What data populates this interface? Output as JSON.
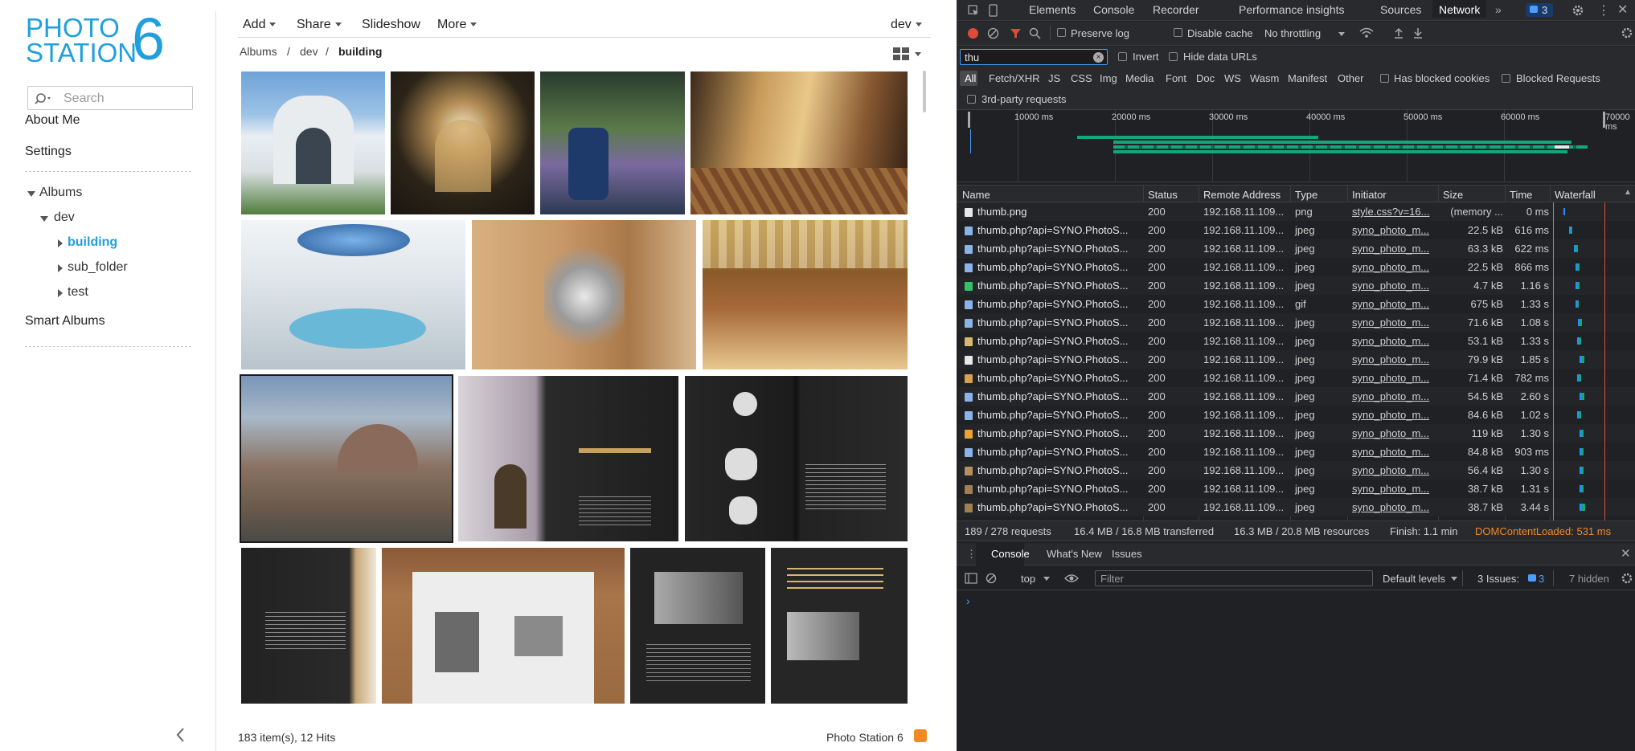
{
  "photo_station": {
    "logo": {
      "line1": "PHOTO",
      "line2": "STATION",
      "number": "6"
    },
    "search_placeholder": "Search",
    "sidebar": {
      "about_me": "About Me",
      "settings": "Settings",
      "albums": "Albums",
      "dev": "dev",
      "building": "building",
      "sub_folder": "sub_folder",
      "test": "test",
      "smart_albums": "Smart Albums"
    },
    "toolbar": {
      "add": "Add",
      "share": "Share",
      "slideshow": "Slideshow",
      "more": "More",
      "user": "dev"
    },
    "breadcrumb": {
      "albums": "Albums",
      "sep": "/",
      "dev": "dev",
      "current": "building"
    },
    "footer": {
      "items": "183 item(s), 12 Hits",
      "brand": "Photo Station 6"
    },
    "colors": {
      "brand": "#1fa0dc",
      "selected": "#1fa0dc",
      "rss": "#f08a24"
    }
  },
  "devtools": {
    "tabs": [
      "Elements",
      "Console",
      "Recorder",
      "Performance insights",
      "Sources",
      "Network"
    ],
    "active_tab": "Network",
    "issues_badge": "3",
    "toolbar": {
      "preserve_log": "Preserve log",
      "disable_cache": "Disable cache",
      "throttling": "No throttling"
    },
    "filter": {
      "value": "thu",
      "invert": "Invert",
      "hide_data_urls": "Hide data URLs"
    },
    "types": [
      "All",
      "Fetch/XHR",
      "JS",
      "CSS",
      "Img",
      "Media",
      "Font",
      "Doc",
      "WS",
      "Wasm",
      "Manifest",
      "Other"
    ],
    "has_blocked_cookies": "Has blocked cookies",
    "blocked_requests": "Blocked Requests",
    "third_party": "3rd-party requests",
    "timeline_labels": [
      "10000 ms",
      "20000 ms",
      "30000 ms",
      "40000 ms",
      "50000 ms",
      "60000 ms",
      "70000 ms"
    ],
    "columns": {
      "name": "Name",
      "status": "Status",
      "remote": "Remote Address",
      "type": "Type",
      "initiator": "Initiator",
      "size": "Size",
      "time": "Time",
      "waterfall": "Waterfall"
    },
    "rows": [
      {
        "name": "thumb.png",
        "status": "200",
        "remote": "192.168.11.109...",
        "type": "png",
        "initiator": "style.css?v=16...",
        "size": "(memory ...",
        "time": "0 ms"
      },
      {
        "name": "thumb.php?api=SYNO.PhotoS...",
        "status": "200",
        "remote": "192.168.11.109...",
        "type": "jpeg",
        "initiator": "syno_photo_m...",
        "size": "22.5 kB",
        "time": "616 ms"
      },
      {
        "name": "thumb.php?api=SYNO.PhotoS...",
        "status": "200",
        "remote": "192.168.11.109...",
        "type": "jpeg",
        "initiator": "syno_photo_m...",
        "size": "63.3 kB",
        "time": "622 ms"
      },
      {
        "name": "thumb.php?api=SYNO.PhotoS...",
        "status": "200",
        "remote": "192.168.11.109...",
        "type": "jpeg",
        "initiator": "syno_photo_m...",
        "size": "22.5 kB",
        "time": "866 ms"
      },
      {
        "name": "thumb.php?api=SYNO.PhotoS...",
        "status": "200",
        "remote": "192.168.11.109...",
        "type": "jpeg",
        "initiator": "syno_photo_m...",
        "size": "4.7 kB",
        "time": "1.16 s"
      },
      {
        "name": "thumb.php?api=SYNO.PhotoS...",
        "status": "200",
        "remote": "192.168.11.109...",
        "type": "gif",
        "initiator": "syno_photo_m...",
        "size": "675 kB",
        "time": "1.33 s"
      },
      {
        "name": "thumb.php?api=SYNO.PhotoS...",
        "status": "200",
        "remote": "192.168.11.109...",
        "type": "jpeg",
        "initiator": "syno_photo_m...",
        "size": "71.6 kB",
        "time": "1.08 s"
      },
      {
        "name": "thumb.php?api=SYNO.PhotoS...",
        "status": "200",
        "remote": "192.168.11.109...",
        "type": "jpeg",
        "initiator": "syno_photo_m...",
        "size": "53.1 kB",
        "time": "1.33 s"
      },
      {
        "name": "thumb.php?api=SYNO.PhotoS...",
        "status": "200",
        "remote": "192.168.11.109...",
        "type": "jpeg",
        "initiator": "syno_photo_m...",
        "size": "79.9 kB",
        "time": "1.85 s"
      },
      {
        "name": "thumb.php?api=SYNO.PhotoS...",
        "status": "200",
        "remote": "192.168.11.109...",
        "type": "jpeg",
        "initiator": "syno_photo_m...",
        "size": "71.4 kB",
        "time": "782 ms"
      },
      {
        "name": "thumb.php?api=SYNO.PhotoS...",
        "status": "200",
        "remote": "192.168.11.109...",
        "type": "jpeg",
        "initiator": "syno_photo_m...",
        "size": "54.5 kB",
        "time": "2.60 s"
      },
      {
        "name": "thumb.php?api=SYNO.PhotoS...",
        "status": "200",
        "remote": "192.168.11.109...",
        "type": "jpeg",
        "initiator": "syno_photo_m...",
        "size": "84.6 kB",
        "time": "1.02 s"
      },
      {
        "name": "thumb.php?api=SYNO.PhotoS...",
        "status": "200",
        "remote": "192.168.11.109...",
        "type": "jpeg",
        "initiator": "syno_photo_m...",
        "size": "119 kB",
        "time": "1.30 s"
      },
      {
        "name": "thumb.php?api=SYNO.PhotoS...",
        "status": "200",
        "remote": "192.168.11.109...",
        "type": "jpeg",
        "initiator": "syno_photo_m...",
        "size": "84.8 kB",
        "time": "903 ms"
      },
      {
        "name": "thumb.php?api=SYNO.PhotoS...",
        "status": "200",
        "remote": "192.168.11.109...",
        "type": "jpeg",
        "initiator": "syno_photo_m...",
        "size": "56.4 kB",
        "time": "1.30 s"
      },
      {
        "name": "thumb.php?api=SYNO.PhotoS...",
        "status": "200",
        "remote": "192.168.11.109...",
        "type": "jpeg",
        "initiator": "syno_photo_m...",
        "size": "38.7 kB",
        "time": "1.31 s"
      },
      {
        "name": "thumb.php?api=SYNO.PhotoS...",
        "status": "200",
        "remote": "192.168.11.109...",
        "type": "jpeg",
        "initiator": "syno_photo_m...",
        "size": "38.7 kB",
        "time": "3.44 s"
      }
    ],
    "status_bar": {
      "requests": "189 / 278 requests",
      "transferred": "16.4 MB / 16.8 MB transferred",
      "resources": "16.3 MB / 20.8 MB resources",
      "finish": "Finish: 1.1 min",
      "domcontent": "DOMContentLoaded: 531 ms"
    },
    "console": {
      "tabs": [
        "Console",
        "What's New",
        "Issues"
      ],
      "context": "top",
      "filter_placeholder": "Filter",
      "levels": "Default levels",
      "issues": "3 Issues:",
      "issues_count": "3",
      "hidden": "7 hidden"
    },
    "colors": {
      "accent": "#4a9eff",
      "waterfall": "#11a87b",
      "domcontent": "#f08a24"
    }
  }
}
